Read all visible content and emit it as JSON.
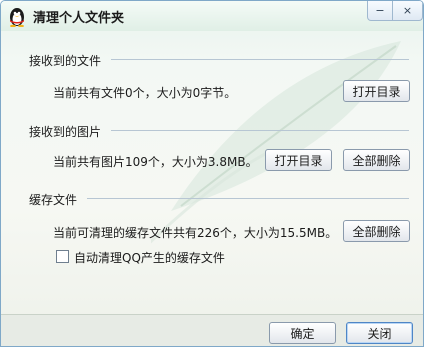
{
  "window": {
    "title": "清理个人文件夹",
    "app_icon": "qq-penguin-icon",
    "minimize_glyph": "−",
    "close_glyph": "×"
  },
  "sections": {
    "received_files": {
      "title": "接收到的文件",
      "info": "当前共有文件0个，大小为0字节。",
      "open_dir_label": "打开目录"
    },
    "received_images": {
      "title": "接收到的图片",
      "info": "当前共有图片109个，大小为3.8MB。",
      "open_dir_label": "打开目录",
      "delete_all_label": "全部删除"
    },
    "cache": {
      "title": "缓存文件",
      "info": "当前可清理的缓存文件共有226个，大小为15.5MB。",
      "delete_all_label": "全部删除",
      "auto_clean_label": "自动清理QQ产生的缓存文件",
      "auto_clean_checked": false
    }
  },
  "footer": {
    "ok_label": "确定",
    "close_label": "关闭"
  }
}
